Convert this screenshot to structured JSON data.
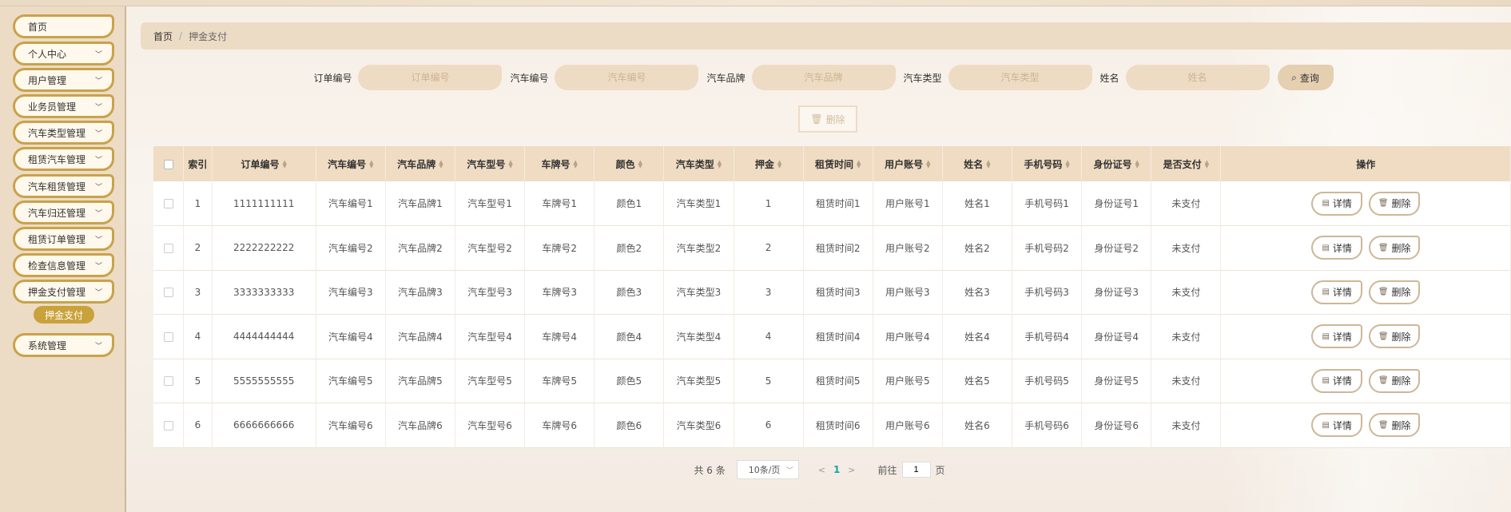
{
  "sidebar": {
    "items": [
      {
        "label": "首页",
        "chevron": false
      },
      {
        "label": "个人中心",
        "chevron": true
      },
      {
        "label": "用户管理",
        "chevron": true
      },
      {
        "label": "业务员管理",
        "chevron": true
      },
      {
        "label": "汽车类型管理",
        "chevron": true
      },
      {
        "label": "租赁汽车管理",
        "chevron": true
      },
      {
        "label": "汽车租赁管理",
        "chevron": true
      },
      {
        "label": "汽车归还管理",
        "chevron": true
      },
      {
        "label": "租赁订单管理",
        "chevron": true
      },
      {
        "label": "检查信息管理",
        "chevron": true
      },
      {
        "label": "押金支付管理",
        "chevron": true
      },
      {
        "label": "系统管理",
        "chevron": true
      }
    ],
    "active_sub": "押金支付"
  },
  "breadcrumb": {
    "home": "首页",
    "separator": "/",
    "current": "押金支付"
  },
  "search": {
    "fields": [
      {
        "label": "订单编号",
        "placeholder": "订单编号"
      },
      {
        "label": "汽车编号",
        "placeholder": "汽车编号"
      },
      {
        "label": "汽车品牌",
        "placeholder": "汽车品牌"
      },
      {
        "label": "汽车类型",
        "placeholder": "汽车类型"
      },
      {
        "label": "姓名",
        "placeholder": "姓名"
      }
    ],
    "query_label": "查询"
  },
  "bulk_delete_label": "删除",
  "table": {
    "columns": [
      "索引",
      "订单编号",
      "汽车编号",
      "汽车品牌",
      "汽车型号",
      "车牌号",
      "颜色",
      "汽车类型",
      "押金",
      "租赁时间",
      "用户账号",
      "姓名",
      "手机号码",
      "身份证号",
      "是否支付",
      "操作"
    ],
    "rows": [
      [
        "1",
        "1111111111",
        "汽车编号1",
        "汽车品牌1",
        "汽车型号1",
        "车牌号1",
        "颜色1",
        "汽车类型1",
        "1",
        "租赁时间1",
        "用户账号1",
        "姓名1",
        "手机号码1",
        "身份证号1",
        "未支付"
      ],
      [
        "2",
        "2222222222",
        "汽车编号2",
        "汽车品牌2",
        "汽车型号2",
        "车牌号2",
        "颜色2",
        "汽车类型2",
        "2",
        "租赁时间2",
        "用户账号2",
        "姓名2",
        "手机号码2",
        "身份证号2",
        "未支付"
      ],
      [
        "3",
        "3333333333",
        "汽车编号3",
        "汽车品牌3",
        "汽车型号3",
        "车牌号3",
        "颜色3",
        "汽车类型3",
        "3",
        "租赁时间3",
        "用户账号3",
        "姓名3",
        "手机号码3",
        "身份证号3",
        "未支付"
      ],
      [
        "4",
        "4444444444",
        "汽车编号4",
        "汽车品牌4",
        "汽车型号4",
        "车牌号4",
        "颜色4",
        "汽车类型4",
        "4",
        "租赁时间4",
        "用户账号4",
        "姓名4",
        "手机号码4",
        "身份证号4",
        "未支付"
      ],
      [
        "5",
        "5555555555",
        "汽车编号5",
        "汽车品牌5",
        "汽车型号5",
        "车牌号5",
        "颜色5",
        "汽车类型5",
        "5",
        "租赁时间5",
        "用户账号5",
        "姓名5",
        "手机号码5",
        "身份证号5",
        "未支付"
      ],
      [
        "6",
        "6666666666",
        "汽车编号6",
        "汽车品牌6",
        "汽车型号6",
        "车牌号6",
        "颜色6",
        "汽车类型6",
        "6",
        "租赁时间6",
        "用户账号6",
        "姓名6",
        "手机号码6",
        "身份证号6",
        "未支付"
      ]
    ],
    "action_detail": "详情",
    "action_delete": "删除"
  },
  "pagination": {
    "total_text": "共 6 条",
    "page_size": "10条/页",
    "current_page": "1",
    "goto_prefix": "前往",
    "goto_value": "1",
    "goto_suffix": "页"
  },
  "colors": {
    "accent_gold": "#c9a24a",
    "sidebar_bg": "#ecdcc5",
    "header_bg": "#efdcc3",
    "active_page": "#18a3a3"
  }
}
